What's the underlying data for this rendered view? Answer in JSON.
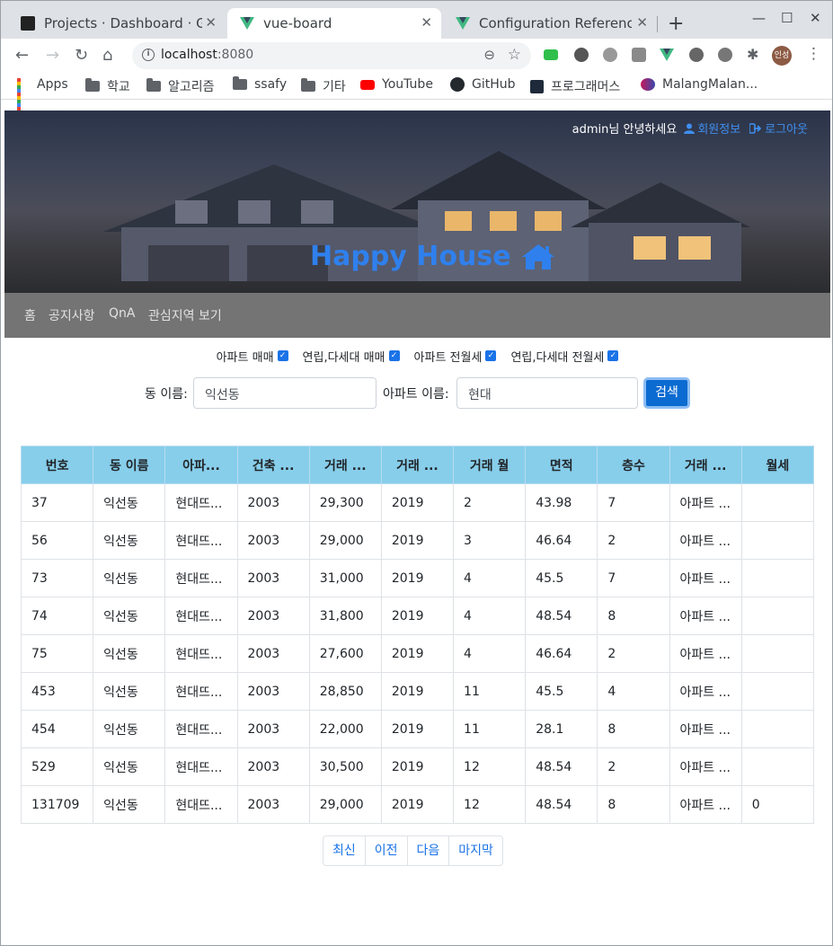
{
  "browser": {
    "tabs": [
      {
        "title": "Projects · Dashboard · Giti",
        "icon": "gitlab-icon"
      },
      {
        "title": "vue-board",
        "icon": "vue-icon"
      },
      {
        "title": "Configuration Reference",
        "icon": "vue-icon"
      }
    ],
    "url_host": "localhost",
    "url_port": ":8080",
    "profile": "인성",
    "bookmarks": [
      "Apps",
      "학교",
      "알고리즘",
      "ssafy",
      "기타",
      "YouTube",
      "GitHub",
      "프로그래머스",
      "MalangMalan..."
    ]
  },
  "header": {
    "greeting": "admin님 안녕하세요",
    "member_info": "회원정보",
    "logout": "로그아웃",
    "brand": "Happy House"
  },
  "nav": [
    "홈",
    "공지사항",
    "QnA",
    "관심지역 보기"
  ],
  "filters": [
    {
      "label": "아파트 매매",
      "checked": true
    },
    {
      "label": "연립,다세대 매매",
      "checked": true
    },
    {
      "label": "아파트 전월세",
      "checked": true
    },
    {
      "label": "연립,다세대 전월세",
      "checked": true
    }
  ],
  "search": {
    "dong_label": "동 이름:",
    "dong_value": "익선동",
    "apt_label": "아파트 이름:",
    "apt_value": "현대",
    "button": "검색"
  },
  "table": {
    "headers": [
      "번호",
      "동 이름",
      "아파...",
      "건축 ...",
      "거래 ...",
      "거래 ...",
      "거래 월",
      "면적",
      "층수",
      "거래 ...",
      "월세"
    ],
    "rows": [
      [
        "37",
        "익선동",
        "현대뜨...",
        "2003",
        "29,300",
        "2019",
        "2",
        "43.98",
        "7",
        "아파트 ...",
        ""
      ],
      [
        "56",
        "익선동",
        "현대뜨...",
        "2003",
        "29,000",
        "2019",
        "3",
        "46.64",
        "2",
        "아파트 ...",
        ""
      ],
      [
        "73",
        "익선동",
        "현대뜨...",
        "2003",
        "31,000",
        "2019",
        "4",
        "45.5",
        "7",
        "아파트 ...",
        ""
      ],
      [
        "74",
        "익선동",
        "현대뜨...",
        "2003",
        "31,800",
        "2019",
        "4",
        "48.54",
        "8",
        "아파트 ...",
        ""
      ],
      [
        "75",
        "익선동",
        "현대뜨...",
        "2003",
        "27,600",
        "2019",
        "4",
        "46.64",
        "2",
        "아파트 ...",
        ""
      ],
      [
        "453",
        "익선동",
        "현대뜨...",
        "2003",
        "28,850",
        "2019",
        "11",
        "45.5",
        "4",
        "아파트 ...",
        ""
      ],
      [
        "454",
        "익선동",
        "현대뜨...",
        "2003",
        "22,000",
        "2019",
        "11",
        "28.1",
        "8",
        "아파트 ...",
        ""
      ],
      [
        "529",
        "익선동",
        "현대뜨...",
        "2003",
        "30,500",
        "2019",
        "12",
        "48.54",
        "2",
        "아파트 ...",
        ""
      ],
      [
        "131709",
        "익선동",
        "현대뜨...",
        "2003",
        "29,000",
        "2019",
        "12",
        "48.54",
        "8",
        "아파트 ...",
        "0"
      ]
    ]
  },
  "pager": [
    "최신",
    "이전",
    "다음",
    "마지막"
  ],
  "colors": {
    "brand": "#2f80ed",
    "header_row": "#87ceeb",
    "button": "#0b6bd1",
    "navbar": "#747474"
  }
}
